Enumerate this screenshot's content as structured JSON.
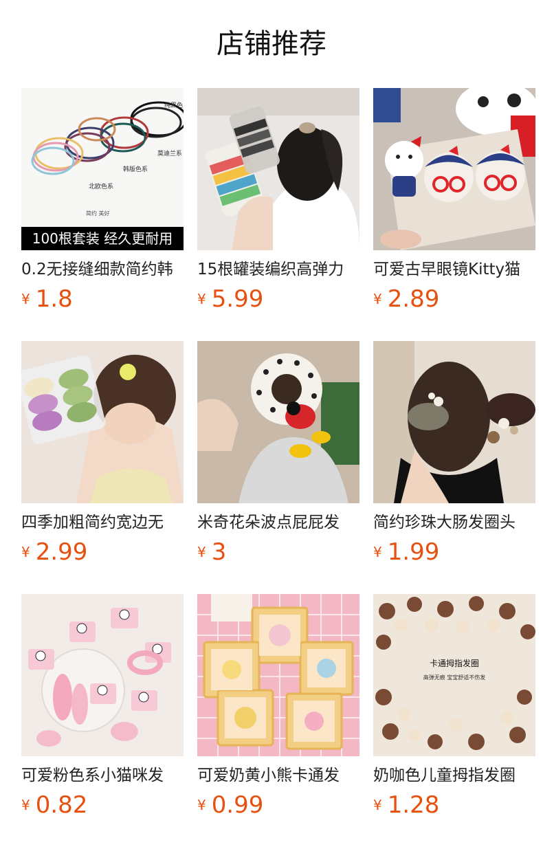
{
  "header": {
    "title": "店铺推荐"
  },
  "products": [
    {
      "title": "0.2无接缝细款简约韩",
      "currency": "¥",
      "price": "1.8",
      "badge": "100根套装 经久更耐用",
      "image_labels": [
        "纯黑色",
        "莫迪兰系",
        "韩版色系",
        "北欧色系",
        "简约 美好"
      ]
    },
    {
      "title": "15根罐装编织高弹力",
      "currency": "¥",
      "price": "5.99"
    },
    {
      "title": "可爱古早眼镜Kitty猫",
      "currency": "¥",
      "price": "2.89"
    },
    {
      "title": "四季加粗简约宽边无",
      "currency": "¥",
      "price": "2.99"
    },
    {
      "title": "米奇花朵波点屁屁发",
      "currency": "¥",
      "price": "3"
    },
    {
      "title": "简约珍珠大肠发圈头",
      "currency": "¥",
      "price": "1.99"
    },
    {
      "title": "可爱粉色系小猫咪发",
      "currency": "¥",
      "price": "0.82"
    },
    {
      "title": "可爱奶黄小熊卡通发",
      "currency": "¥",
      "price": "0.99"
    },
    {
      "title": "奶咖色儿童拇指发圈",
      "currency": "¥",
      "price": "1.28",
      "image_labels": [
        "卡通拇指发圈",
        "高弹无痕 宝宝舒适不伤发"
      ]
    }
  ],
  "colors": {
    "price": "#e8500f",
    "title": "#111111",
    "text": "#222222"
  }
}
